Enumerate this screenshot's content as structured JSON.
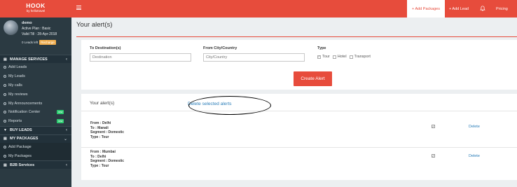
{
  "brand": {
    "name": "HOOK",
    "sub": "by hellotravel"
  },
  "profile": {
    "username": "demo",
    "plan": "Active Plan : Basic",
    "valid": "Valid Till : 28-Apr-2018",
    "leads_left": "0 Leads left",
    "recharge": "Recharge"
  },
  "sidebar": {
    "manage_services": "MANAGE SERVICES",
    "manage_items": [
      {
        "label": "Add Leads"
      },
      {
        "label": "My Leads"
      },
      {
        "label": "My calls"
      },
      {
        "label": "My reviews"
      },
      {
        "label": "My Announcements"
      },
      {
        "label": "Notification Center",
        "badge": "new"
      },
      {
        "label": "Reports",
        "badge": "new"
      }
    ],
    "buy_leads": "BUY LEADS",
    "my_packages": "MY PACKAGES",
    "package_items": [
      {
        "label": "Add Package"
      },
      {
        "label": "My Packages"
      }
    ],
    "b2b": "B2B Services"
  },
  "topbar": {
    "add_packages": "+ Add Packages",
    "add_lead": "+ Add Lead",
    "pricing": "Pricing",
    "accent": "#e74c3c"
  },
  "page": {
    "title": "Your alert(s)"
  },
  "form": {
    "to_label": "To Destination(s)",
    "to_placeholder": "Destination",
    "from_label": "From City/Country",
    "from_placeholder": "City/Country",
    "type_label": "Type",
    "type_options": [
      {
        "label": "Tour",
        "checked": true
      },
      {
        "label": "Hotel",
        "checked": false
      },
      {
        "label": "Transport",
        "checked": false
      }
    ],
    "create_button": "Create Alert"
  },
  "alerts": {
    "header": "Your alert(s)",
    "delete_selected": "Delete selected alerts",
    "rows": [
      {
        "from": "From : Delhi",
        "to": "To : Manali",
        "segment": "Segment : Domestic",
        "type": "Type : Tour",
        "checked": true,
        "delete": "Delete"
      },
      {
        "from": "From : Mumbai",
        "to": "To : Delhi",
        "segment": "Segment : Domestic",
        "type": "Type : Tour",
        "checked": true,
        "delete": "Delete"
      }
    ]
  }
}
